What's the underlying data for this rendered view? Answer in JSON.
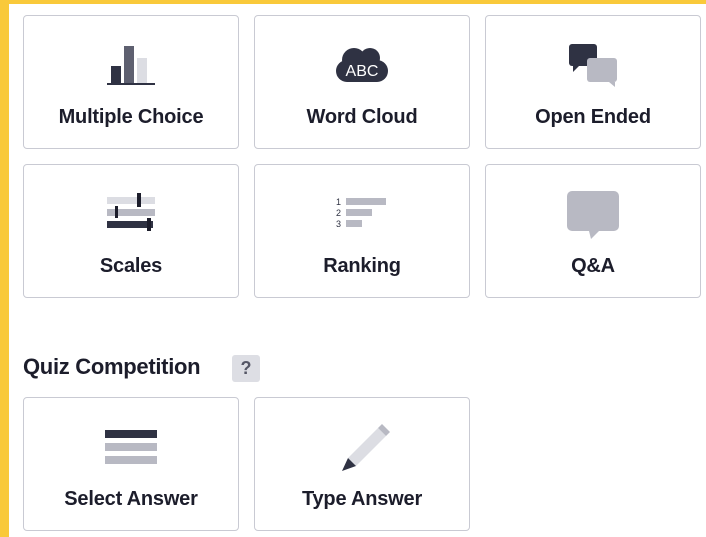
{
  "slide_types": [
    {
      "label": "Multiple Choice",
      "icon": "bar-chart-icon"
    },
    {
      "label": "Word Cloud",
      "icon": "word-cloud-icon",
      "icon_text": "ABC"
    },
    {
      "label": "Open Ended",
      "icon": "speech-bubbles-icon"
    },
    {
      "label": "Scales",
      "icon": "sliders-icon"
    },
    {
      "label": "Ranking",
      "icon": "ranking-icon",
      "rank_numbers": [
        "1",
        "2",
        "3"
      ]
    },
    {
      "label": "Q&A",
      "icon": "chat-bubble-icon"
    }
  ],
  "quiz_section": {
    "title": "Quiz Competition",
    "help": "?",
    "items": [
      {
        "label": "Select Answer",
        "icon": "list-lines-icon"
      },
      {
        "label": "Type Answer",
        "icon": "pencil-icon"
      }
    ]
  },
  "colors": {
    "accent_yellow": "#f9c93a",
    "icon_dark": "#2f3243",
    "icon_mid": "#5e6070",
    "icon_light": "#b8b9c3"
  }
}
